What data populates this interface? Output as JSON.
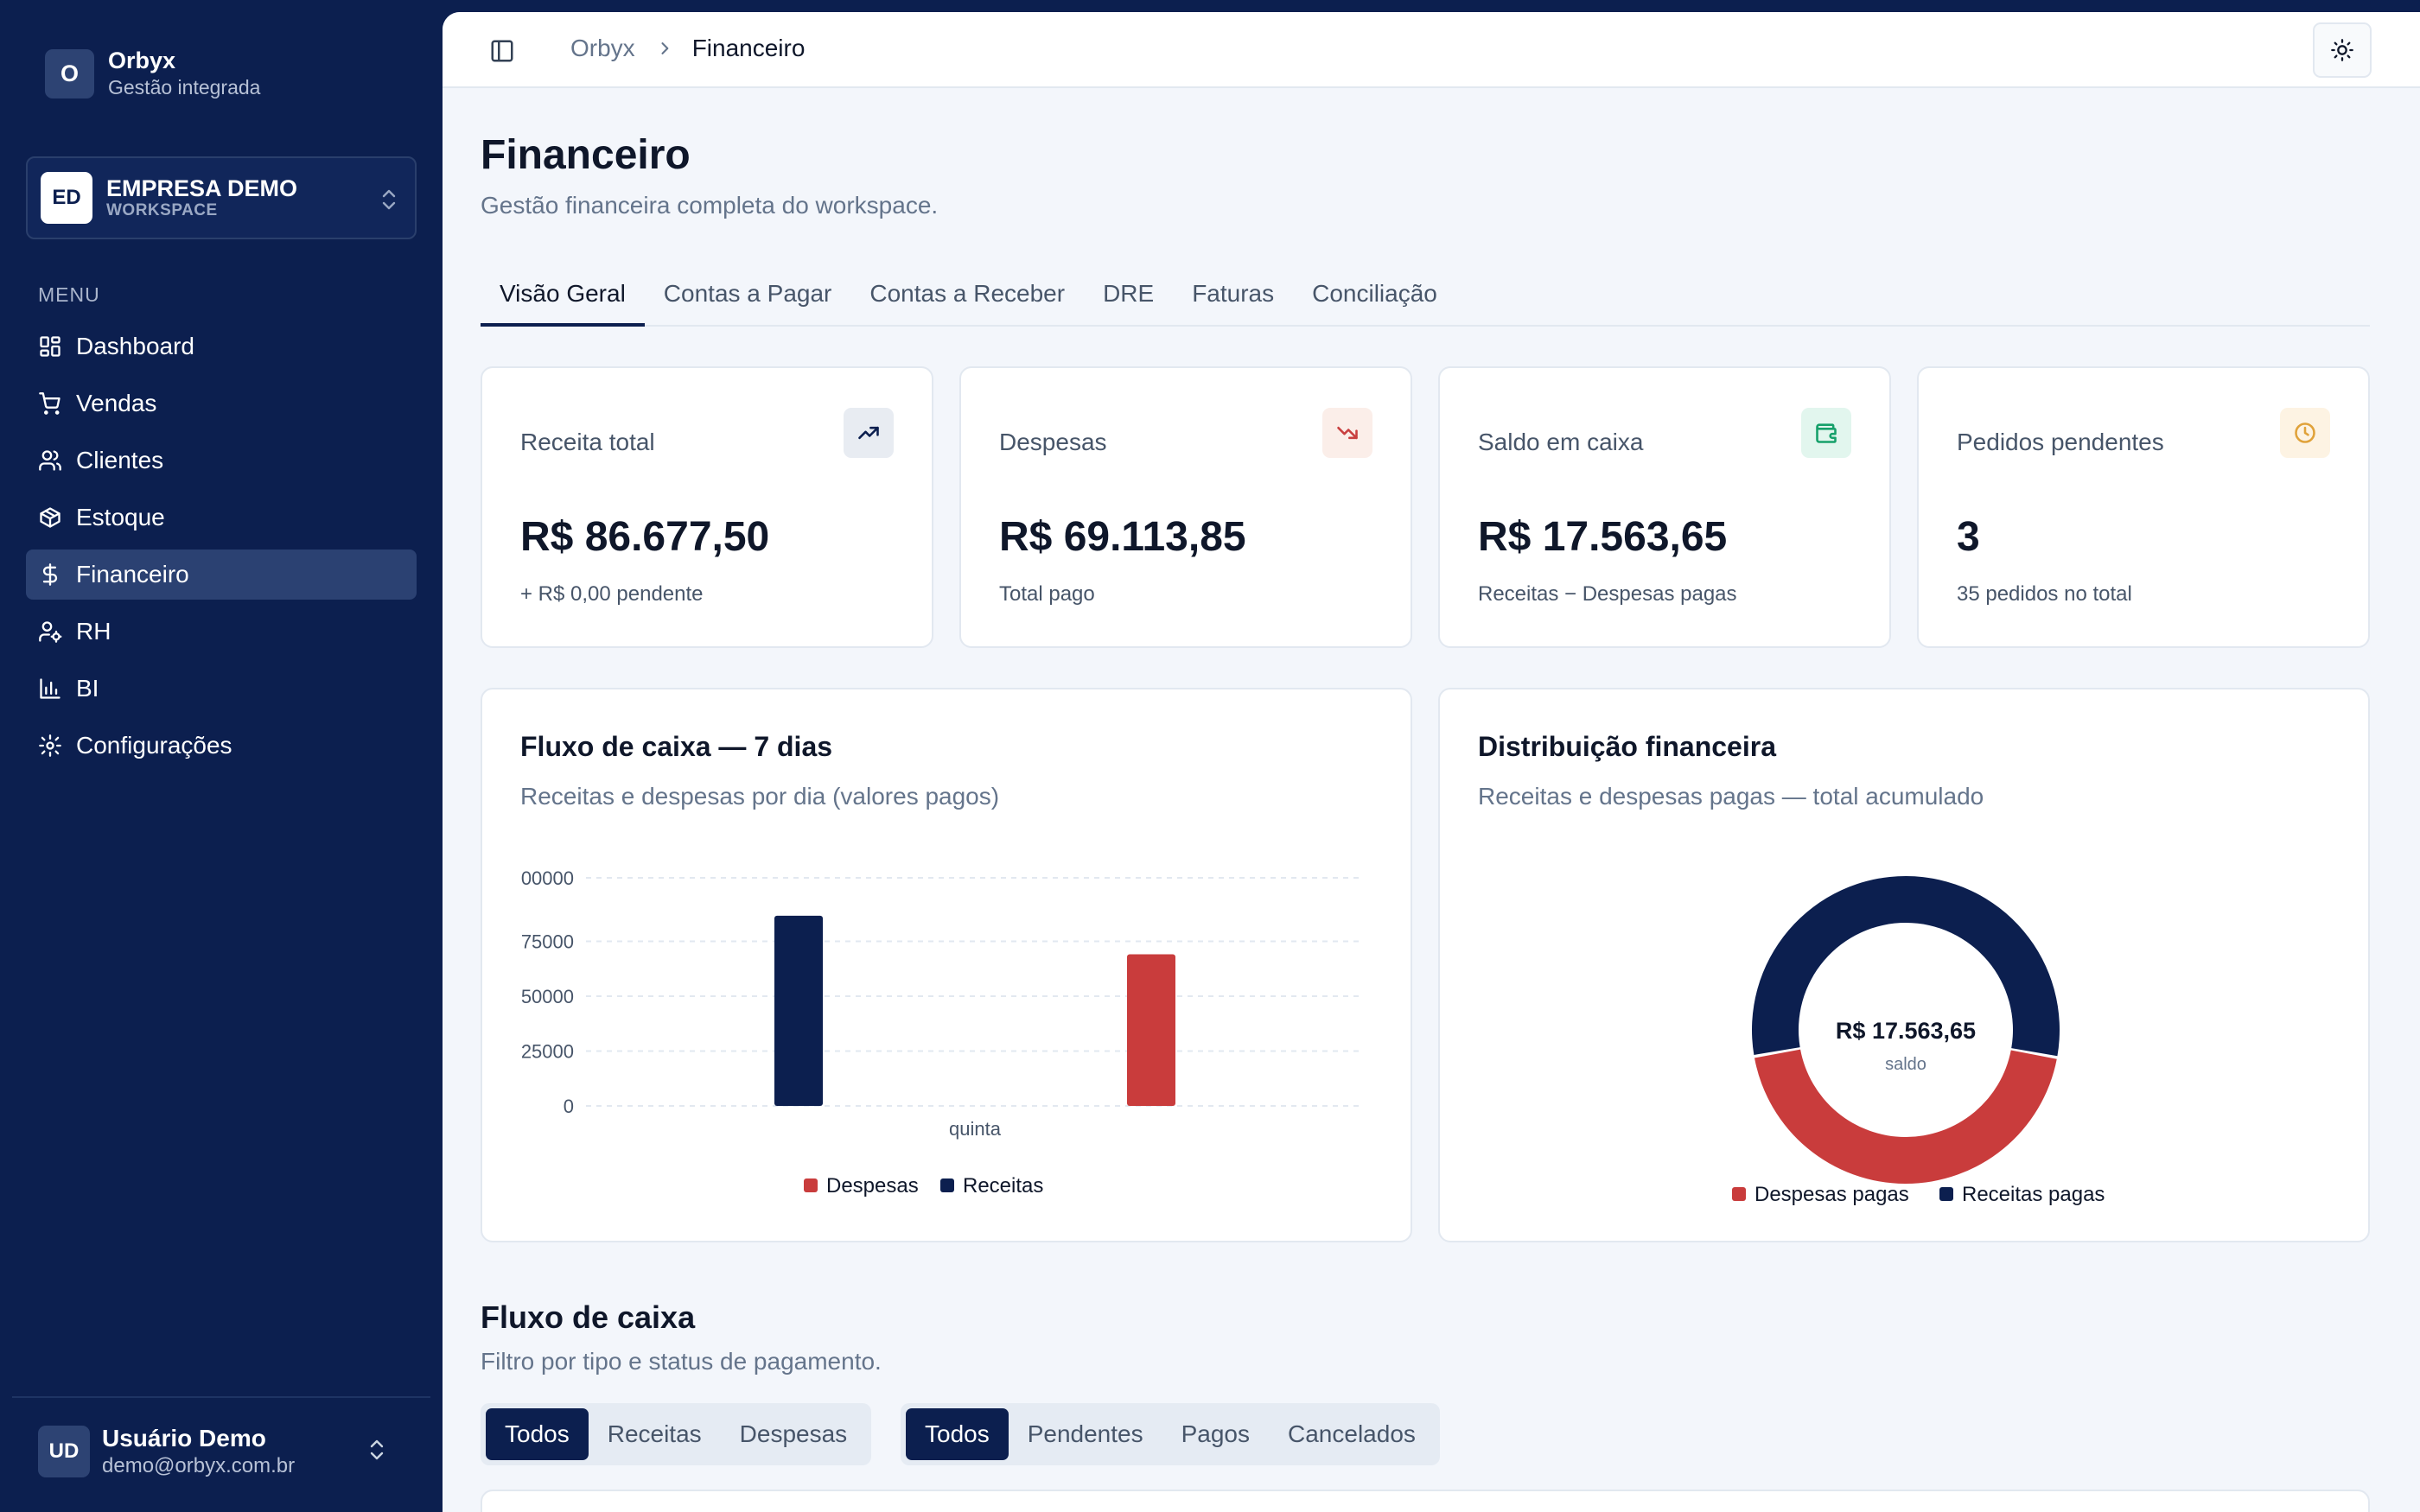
{
  "brand": {
    "logo": "O",
    "name": "Orbyx",
    "subtitle": "Gestão integrada"
  },
  "workspace": {
    "logo": "ED",
    "name": "EMPRESA DEMO",
    "label": "WORKSPACE"
  },
  "menu": {
    "title": "MENU",
    "items": [
      {
        "label": "Dashboard",
        "icon": "dashboard-icon"
      },
      {
        "label": "Vendas",
        "icon": "cart-icon"
      },
      {
        "label": "Clientes",
        "icon": "users-icon"
      },
      {
        "label": "Estoque",
        "icon": "package-icon"
      },
      {
        "label": "Financeiro",
        "icon": "dollar-icon",
        "active": true
      },
      {
        "label": "RH",
        "icon": "user-cog-icon"
      },
      {
        "label": "BI",
        "icon": "bar-chart-icon"
      },
      {
        "label": "Configurações",
        "icon": "gear-icon"
      }
    ]
  },
  "user": {
    "initials": "UD",
    "name": "Usuário Demo",
    "email": "demo@orbyx.com.br"
  },
  "breadcrumb": {
    "root": "Orbyx",
    "current": "Financeiro"
  },
  "page": {
    "title": "Financeiro",
    "subtitle": "Gestão financeira completa do workspace."
  },
  "tabs": [
    {
      "label": "Visão Geral",
      "active": true
    },
    {
      "label": "Contas a Pagar"
    },
    {
      "label": "Contas a Receber"
    },
    {
      "label": "DRE"
    },
    {
      "label": "Faturas"
    },
    {
      "label": "Conciliação"
    }
  ],
  "stats": [
    {
      "label": "Receita total",
      "value": "R$ 86.677,50",
      "note": "+ R$ 0,00 pendente",
      "icon": "trending-up-icon",
      "icon_bg": "#e8ecf2",
      "icon_color": "#0c1f4f"
    },
    {
      "label": "Despesas",
      "value": "R$ 69.113,85",
      "note": "Total pago",
      "icon": "trending-down-icon",
      "icon_bg": "#fbeee9",
      "icon_color": "#c94040"
    },
    {
      "label": "Saldo em caixa",
      "value": "R$ 17.563,65",
      "note": "Receitas − Despesas pagas",
      "icon": "wallet-icon",
      "icon_bg": "#e2f6ee",
      "icon_color": "#16a06a"
    },
    {
      "label": "Pedidos pendentes",
      "value": "3",
      "note": "35 pedidos no total",
      "icon": "clock-icon",
      "icon_bg": "#fdf3e3",
      "icon_color": "#e0a23a"
    }
  ],
  "cashflow_card": {
    "title": "Fluxo de caixa — 7 dias",
    "subtitle": "Receitas e despesas por dia (valores pagos)"
  },
  "distribution_card": {
    "title": "Distribuição financeira",
    "subtitle": "Receitas e despesas pagas — total acumulado"
  },
  "chart_data": [
    {
      "type": "bar",
      "categories": [
        "quinta"
      ],
      "series": [
        {
          "name": "Receitas",
          "values": [
            86677.5
          ],
          "color": "#0c1f4f"
        },
        {
          "name": "Despesas",
          "values": [
            69113.85
          ],
          "color": "#c93c3c"
        }
      ],
      "yticks": [
        "0",
        "25000",
        "50000",
        "75000",
        "00000"
      ],
      "ylim": [
        0,
        100000
      ],
      "grid": true,
      "legend": [
        "Despesas",
        "Receitas"
      ],
      "legend_position": "bottom"
    },
    {
      "type": "pie",
      "donut": true,
      "slices": [
        {
          "name": "Receitas pagas",
          "value": 86677.5,
          "color": "#0c1f4f"
        },
        {
          "name": "Despesas pagas",
          "value": 69113.85,
          "color": "#c93c3c"
        }
      ],
      "center_value": "R$ 17.563,65",
      "center_label": "saldo",
      "legend": [
        "Despesas pagas",
        "Receitas pagas"
      ],
      "legend_position": "bottom"
    }
  ],
  "cashflow_section": {
    "title": "Fluxo de caixa",
    "subtitle": "Filtro por tipo e status de pagamento."
  },
  "type_filter": [
    {
      "label": "Todos",
      "active": true
    },
    {
      "label": "Receitas"
    },
    {
      "label": "Despesas"
    }
  ],
  "status_filter": [
    {
      "label": "Todos",
      "active": true
    },
    {
      "label": "Pendentes"
    },
    {
      "label": "Pagos"
    },
    {
      "label": "Cancelados"
    }
  ]
}
